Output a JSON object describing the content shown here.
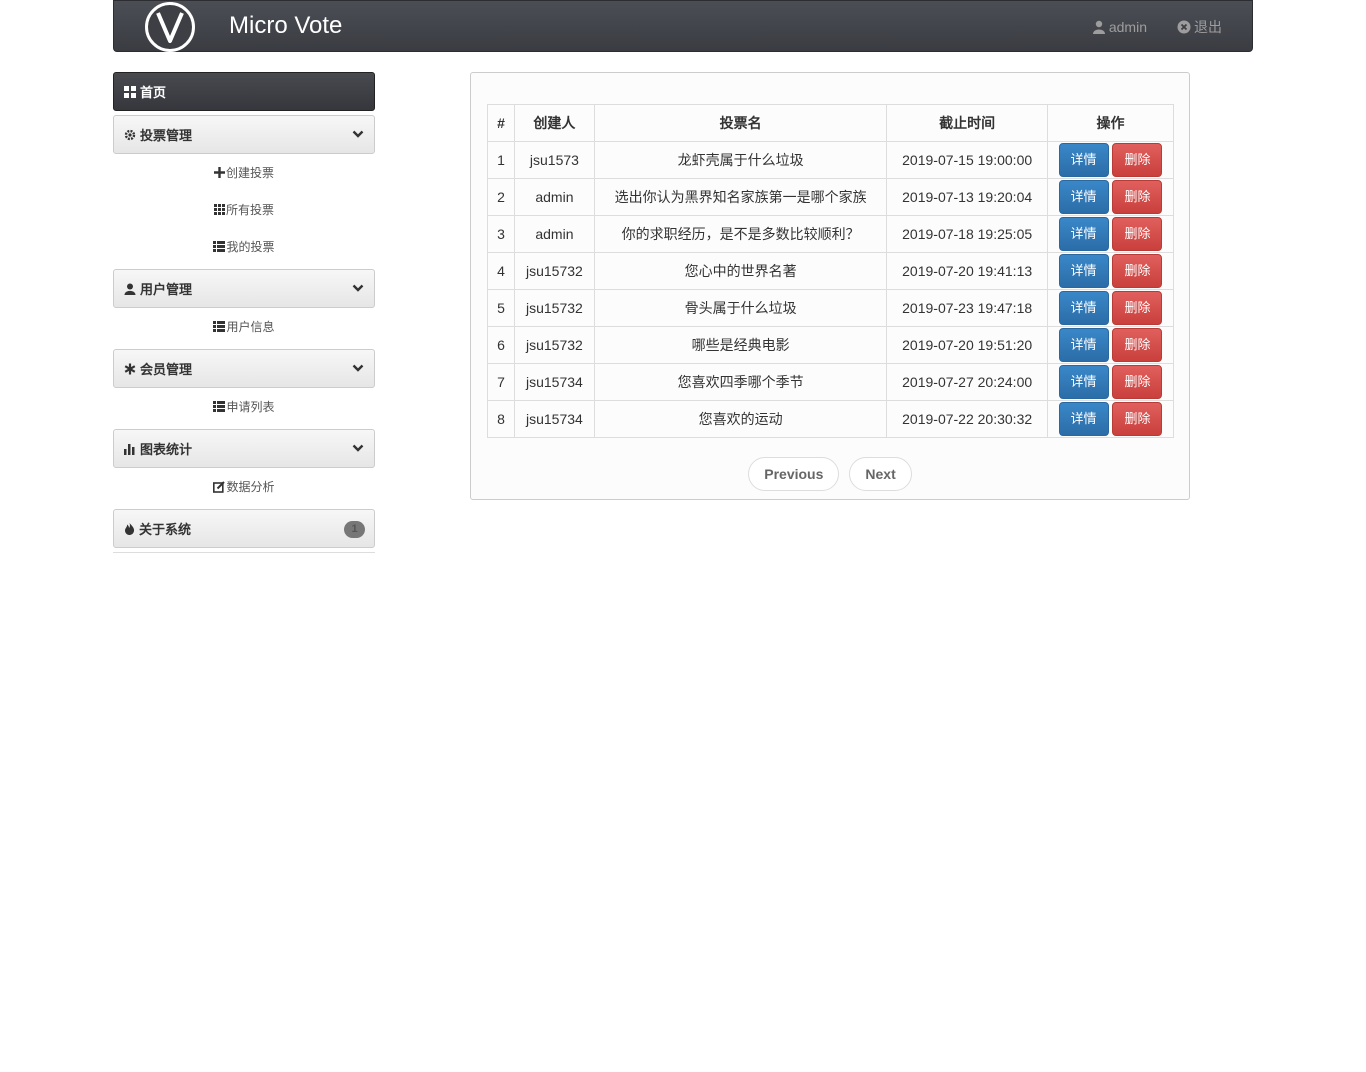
{
  "header": {
    "brand": "Micro Vote",
    "user": "admin",
    "logout": "退出"
  },
  "sidebar": {
    "home": "首页",
    "groups": [
      {
        "label": "投票管理",
        "icon": "gear-icon",
        "items": [
          {
            "label": "创建投票",
            "icon": "plus-icon"
          },
          {
            "label": "所有投票",
            "icon": "grid-icon"
          },
          {
            "label": "我的投票",
            "icon": "list-icon"
          }
        ]
      },
      {
        "label": "用户管理",
        "icon": "user-icon",
        "items": [
          {
            "label": "用户信息",
            "icon": "list-icon"
          }
        ]
      },
      {
        "label": "会员管理",
        "icon": "asterisk-icon",
        "items": [
          {
            "label": "申请列表",
            "icon": "list-icon"
          }
        ]
      },
      {
        "label": "图表统计",
        "icon": "chart-icon",
        "items": [
          {
            "label": "数据分析",
            "icon": "edit-icon"
          }
        ]
      }
    ],
    "about": {
      "label": "关于系统",
      "icon": "fire-icon",
      "badge": "1"
    }
  },
  "table": {
    "headers": [
      "#",
      "创建人",
      "投票名",
      "截止时间",
      "操作"
    ],
    "detail_label": "详情",
    "delete_label": "删除",
    "rows": [
      {
        "num": "1",
        "creator": "jsu1573",
        "name": "龙虾壳属于什么垃圾",
        "deadline": "2019-07-15 19:00:00"
      },
      {
        "num": "2",
        "creator": "admin",
        "name": "选出你认为黑界知名家族第一是哪个家族",
        "deadline": "2019-07-13 19:20:04"
      },
      {
        "num": "3",
        "creator": "admin",
        "name": "你的求职经历，是不是多数比较顺利？",
        "deadline": "2019-07-18 19:25:05"
      },
      {
        "num": "4",
        "creator": "jsu15732",
        "name": "您心中的世界名著",
        "deadline": "2019-07-20 19:41:13"
      },
      {
        "num": "5",
        "creator": "jsu15732",
        "name": "骨头属于什么垃圾",
        "deadline": "2019-07-23 19:47:18"
      },
      {
        "num": "6",
        "creator": "jsu15732",
        "name": "哪些是经典电影",
        "deadline": "2019-07-20 19:51:20"
      },
      {
        "num": "7",
        "creator": "jsu15734",
        "name": "您喜欢四季哪个季节",
        "deadline": "2019-07-27 20:24:00"
      },
      {
        "num": "8",
        "creator": "jsu15734",
        "name": "您喜欢的运动",
        "deadline": "2019-07-22 20:30:32"
      }
    ]
  },
  "pager": {
    "previous": "Previous",
    "next": "Next"
  }
}
